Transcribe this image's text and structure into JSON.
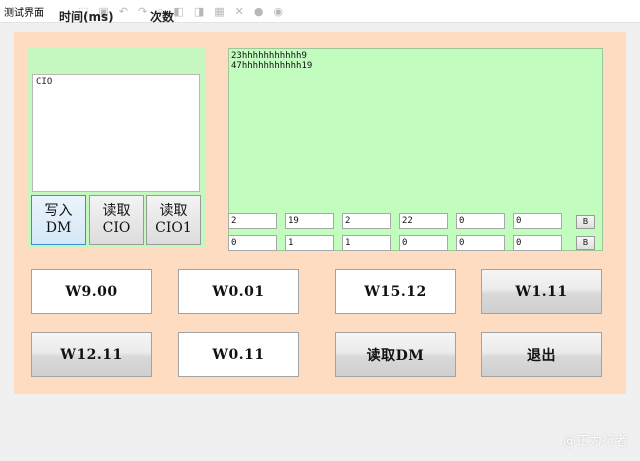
{
  "window": {
    "title": "测试界面"
  },
  "toolbar_ghost": [
    "⬚",
    "▣",
    "↶",
    "↷",
    "⌕",
    "◧",
    "◨",
    "▦",
    "✕",
    "●",
    "◉"
  ],
  "left_panel": {
    "header_time": "时间(ms)",
    "header_count": "次数",
    "list_text": "CIO",
    "buttons": [
      {
        "line1": "写入",
        "line2": "DM"
      },
      {
        "line1": "读取",
        "line2": "CIO"
      },
      {
        "line1": "读取",
        "line2": "CIO1"
      }
    ]
  },
  "output": {
    "line1": "23hhhhhhhhhhh9",
    "line2": "47hhhhhhhhhhh19"
  },
  "fields_row1": [
    "2",
    "19",
    "2",
    "22",
    "0",
    "0"
  ],
  "fields_row2": [
    "0",
    "1",
    "1",
    "0",
    "0",
    "0"
  ],
  "b_button_label": "B",
  "main_buttons": {
    "r1c1": "W9.00",
    "r1c2": "W0.01",
    "r1c3": "W15.12",
    "r1c4": "W1.11",
    "r2c1": "W12.11",
    "r2c2": "W0.11",
    "r2c3": "读取DM",
    "r2c4": "退出"
  },
  "watermark": "@正为行者",
  "colors": {
    "frame_bg": "#fddcc2",
    "panel_green": "#c7f7c0",
    "output_green": "#c2fcbf"
  }
}
